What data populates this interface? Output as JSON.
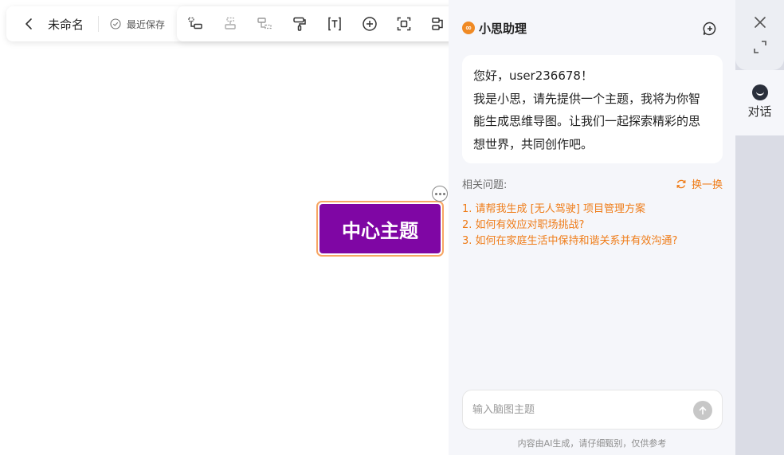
{
  "toolbar": {
    "doc_name": "未命名",
    "save_status": "最近保存"
  },
  "canvas": {
    "central_node": "中心主题"
  },
  "assistant": {
    "title": "小思助理",
    "greeting_lines": "您好，user236678！\n我是小思，请先提供一个主题，我将为你智能生成思维导图。让我们一起探索精彩的思想世界，共同创作吧。",
    "related_label": "相关问题:",
    "refresh_label": "换一换",
    "questions": [
      "1. 请帮我生成 [无人驾驶] 项目管理方案",
      "2. 如何有效应对职场挑战?",
      "3. 如何在家庭生活中保持和谐关系并有效沟通?"
    ],
    "input_placeholder": "输入脑图主题",
    "disclaimer": "内容由AI生成，请仔细甄别，仅供参考"
  },
  "rail": {
    "chat_tab_label": "对话"
  },
  "colors": {
    "accent": "#ef7c18",
    "node_fill": "#7f06a4",
    "node_border": "#f7a664"
  },
  "icons": [
    "chevron-left-icon",
    "check-circle-icon",
    "add-child-icon",
    "add-sibling-icon",
    "add-parent-icon",
    "format-painter-icon",
    "text-icon",
    "insert-icon",
    "select-icon",
    "layout-icon",
    "new-chat-icon",
    "refresh-icon",
    "send-icon",
    "close-icon",
    "expand-icon",
    "chat-icon",
    "more-icon"
  ]
}
